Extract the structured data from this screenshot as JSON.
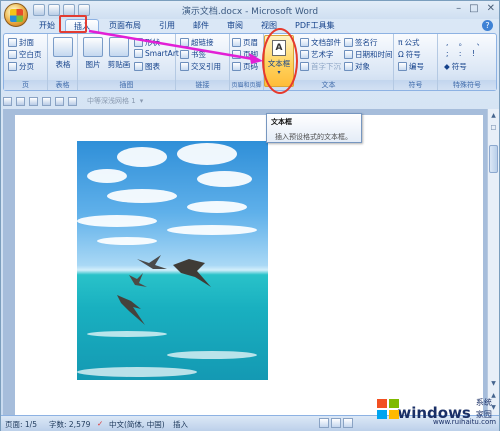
{
  "window": {
    "title": "演示文档.docx - Microsoft Word"
  },
  "tabs": [
    {
      "label": "开始"
    },
    {
      "label": "插入"
    },
    {
      "label": "页面布局"
    },
    {
      "label": "引用"
    },
    {
      "label": "邮件"
    },
    {
      "label": "审阅"
    },
    {
      "label": "视图"
    },
    {
      "label": "PDF工具集"
    }
  ],
  "ribbon": {
    "pages": {
      "label": "页",
      "items": [
        "封面",
        "空白页",
        "分页"
      ]
    },
    "tables": {
      "label": "表格",
      "item": "表格"
    },
    "illustrations": {
      "label": "插图",
      "items": [
        "图片",
        "剪贴画",
        "形状",
        "SmartArt",
        "图表"
      ]
    },
    "links": {
      "label": "链接",
      "items": [
        "超链接",
        "书签",
        "交叉引用"
      ]
    },
    "header_footer": {
      "label": "页眉和页脚",
      "items": [
        "页眉",
        "页脚",
        "页码"
      ]
    },
    "text": {
      "label": "文本",
      "textbox": "文本框",
      "items": [
        "文档部件",
        "艺术字",
        "首字下沉",
        "签名行",
        "日期和时间",
        "对象"
      ]
    },
    "symbols": {
      "label": "符号",
      "items": [
        "公式",
        "符号",
        "编号"
      ]
    },
    "special": {
      "label": "特殊符号",
      "items": [
        "符号"
      ]
    }
  },
  "tooltip": {
    "title": "文本框",
    "body": "插入预设格式的文本框。"
  },
  "formatbar": {
    "style_placeholder": "中等深浅网格 1"
  },
  "status": {
    "page": "页面: 1/5",
    "words": "字数: 2,579",
    "language": "中文(简体, 中国)",
    "mode": "插入"
  },
  "watermark": {
    "brand": "windows",
    "sub": "系统家园",
    "url": "www.ruihaitu.com"
  }
}
